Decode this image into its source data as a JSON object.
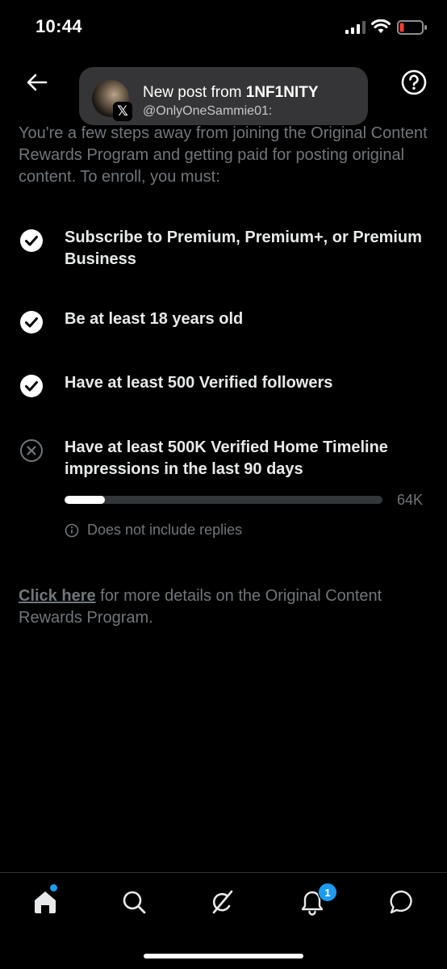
{
  "status_bar": {
    "time": "10:44",
    "battery_color": "#ff3b30"
  },
  "notification": {
    "title_prefix": "New post from ",
    "title_name": "1NF1NITY",
    "subtitle": "@OnlyOneSammie01:",
    "badge_glyph": "𝕏"
  },
  "intro": {
    "text": "You're a few steps away from joining the Original Content Rewards Program and getting paid for posting original content. To enroll, you must:"
  },
  "requirements": [
    {
      "text": "Subscribe to Premium, Premium+, or Premium Business",
      "met": true,
      "icon": "check-circle-icon"
    },
    {
      "text": "Be at least 18 years old",
      "met": true,
      "icon": "check-circle-icon"
    },
    {
      "text": "Have at least 500 Verified followers",
      "met": true,
      "icon": "check-circle-icon"
    },
    {
      "text": "Have at least 500K Verified Home Timeline impressions in the last 90 days",
      "met": false,
      "icon": "x-circle-icon"
    }
  ],
  "progress": {
    "value_label": "64K",
    "fraction": 0.128,
    "note": "Does not include replies"
  },
  "details": {
    "link_text": "Click here",
    "rest_text": " for more details on the Original Content Rewards Program."
  },
  "bottom_nav": {
    "notification_count": "1",
    "accent_color": "#1d9bf0"
  }
}
